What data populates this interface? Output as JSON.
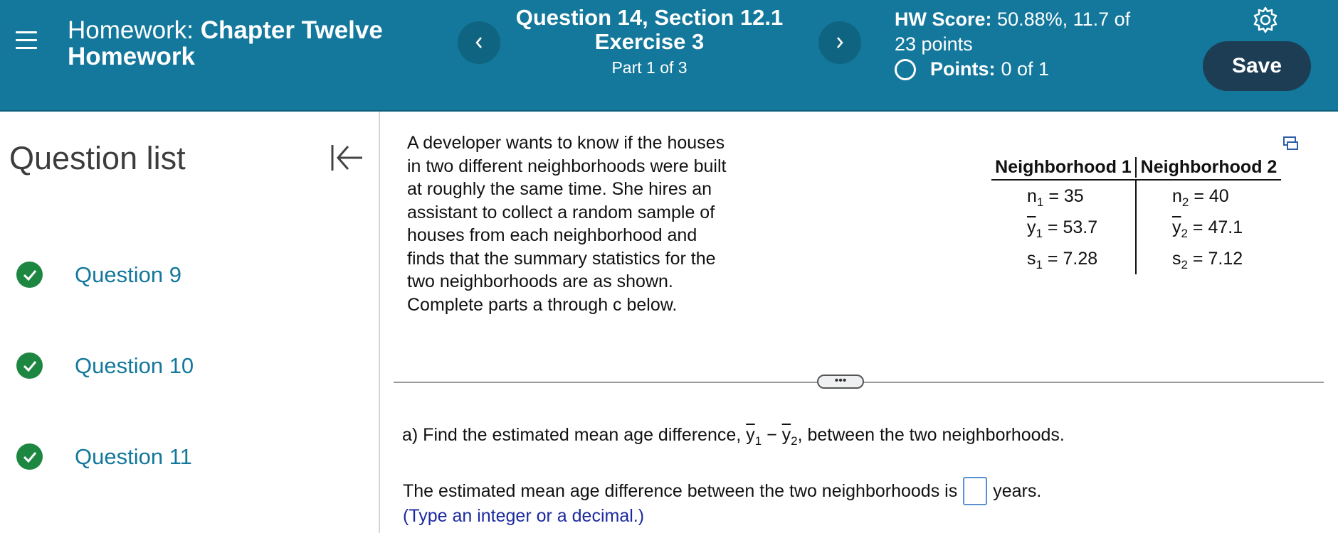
{
  "header": {
    "hw_label": "Homework:",
    "hw_name_line1": "Chapter Twelve",
    "hw_name_line2": "Homework",
    "question_title_line1": "Question 14, Section 12.1",
    "question_title_line2": "Exercise 3",
    "part": "Part 1 of 3",
    "score_label": "HW Score:",
    "score_value": "50.88%, 11.7 of",
    "score_value_line2": "23 points",
    "points_label": "Points:",
    "points_value": "0 of 1",
    "save_label": "Save",
    "prev_icon": "chevron-left-icon",
    "next_icon": "chevron-right-icon"
  },
  "sidebar": {
    "title": "Question list",
    "items": [
      {
        "label": "Question 9",
        "status": "complete"
      },
      {
        "label": "Question 10",
        "status": "complete"
      },
      {
        "label": "Question 11",
        "status": "complete"
      }
    ]
  },
  "problem": {
    "text": "A developer wants to know if the houses in two different neighborhoods were built at roughly the same time. She hires an assistant to collect a random sample of houses from each neighborhood and finds that the summary statistics for the two neighborhoods are as shown. Complete parts a through c below."
  },
  "stats_table": {
    "header1": "Neighborhood 1",
    "header2": "Neighborhood 2",
    "n1": "= 35",
    "n2": "= 40",
    "y1": "= 53.7",
    "y2": "= 47.1",
    "s1": "= 7.28",
    "s2": "= 7.12"
  },
  "more_label": "•••",
  "part_a": {
    "prefix": "a) Find the estimated mean age difference,",
    "suffix": ", between the two neighborhoods.",
    "answer_prefix": "The estimated mean age difference between the two neighborhoods is",
    "answer_value": "",
    "answer_suffix": "years.",
    "hint": "(Type an integer or a decimal.)"
  },
  "colors": {
    "header_bg": "#13789b",
    "save_bg": "#1d3d55",
    "check_green": "#1d8742",
    "link_blue": "#13789b",
    "hint_blue": "#1b2aa0"
  }
}
